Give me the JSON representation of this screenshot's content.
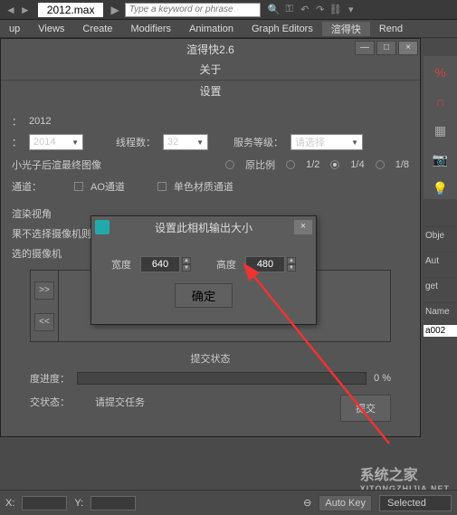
{
  "topbar": {
    "filename": "2012.max",
    "search_placeholder": "Type a keyword or phrase"
  },
  "menubar": {
    "items": [
      "up",
      "Views",
      "Create",
      "Modifiers",
      "Animation",
      "Graph Editors",
      "渲得快",
      "Rend"
    ]
  },
  "dialog": {
    "title": "渲得快2.6",
    "about": "关于",
    "settings": "设置",
    "year_value": "2012",
    "plugin_label": "",
    "plugin_value": "2014",
    "threads_label": "线程数：",
    "threads_value": "32",
    "service_label": "服务等级：",
    "service_value": "请选择",
    "final_image_label": "小光子后渲最终图像",
    "ratio_original": "原比例",
    "ratio_half": "1/2",
    "ratio_quarter": "1/4",
    "ratio_eighth": "1/8",
    "channel_label": "通道：",
    "ao_channel": "AO通道",
    "material_channel": "单色材质通道",
    "render_view": "渲染视角",
    "no_camera_hint": "果不选择摄像机则",
    "selected_camera": "选的摄像机",
    "nav_prev": ">>",
    "nav_next": "<<",
    "submit_status": "提交状态",
    "progress_label": "度进度：",
    "progress_percent": "0 %",
    "status_label": "交状态：",
    "status_value": "请提交任务",
    "submit_btn": "提交"
  },
  "modal": {
    "title": "设置此相机输出大小",
    "width_label": "宽度",
    "width_value": "640",
    "height_label": "高度",
    "height_value": "480",
    "ok": "确定"
  },
  "right": {
    "percent": "%",
    "obj": "Obje",
    "aut": "Aut",
    "get": "get",
    "name": "Name",
    "a002": "a002"
  },
  "statusbar": {
    "x_label": "X:",
    "y_label": "Y:",
    "autokey": "Auto Key",
    "selected": "Selected"
  },
  "watermark": {
    "main": "系统之家",
    "sub": "XITONGZHIJIA.NET"
  }
}
